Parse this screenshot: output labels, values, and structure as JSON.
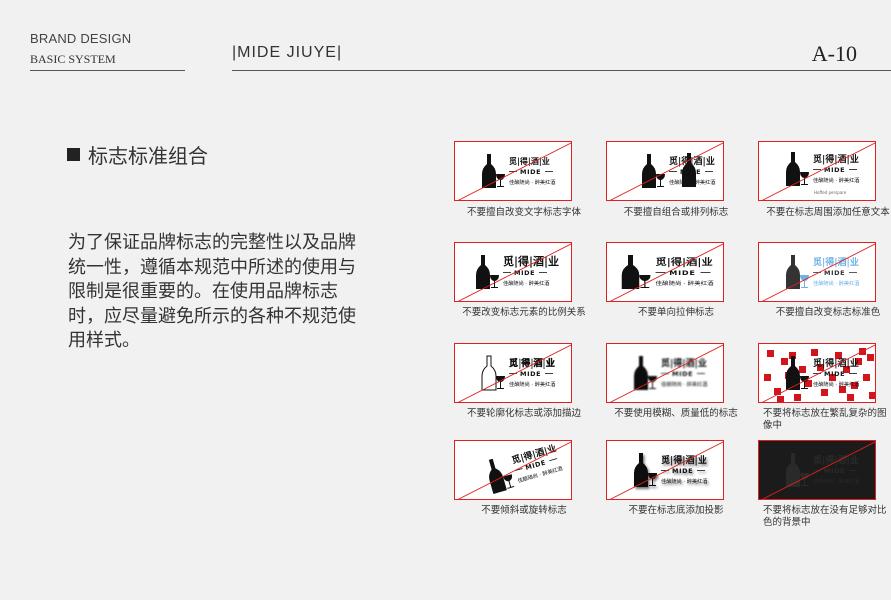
{
  "header": {
    "brand_line1": "BRAND DESIGN",
    "brand_line2": "BASIC SYSTEM",
    "project": "|MIDE  JIUYE|",
    "page_code": "A-10"
  },
  "section": {
    "title": "标志标准组合",
    "description": "为了保证品牌标志的完整性以及品牌统一性，遵循本规范中所述的使用与限制是很重要的。在使用品牌标志时，应尽量避免所示的各种不规范使用样式。"
  },
  "logo_text": {
    "name": "觅|得|酒|业",
    "mide": "MIDE",
    "slogan": "佳酿随尚 · 醉美红酒",
    "sub": "Hoffed perspare"
  },
  "examples": [
    {
      "caption": "不要擅自改变文字标志字体"
    },
    {
      "caption": "不要擅自组合或排列标志"
    },
    {
      "caption": "不要在标志周围添加任意文本"
    },
    {
      "caption": "不要改变标志元素的比例关系"
    },
    {
      "caption": "不要单向拉伸标志"
    },
    {
      "caption": "不要擅自改变标志标准色"
    },
    {
      "caption": "不要轮廓化标志或添加描边"
    },
    {
      "caption": "不要使用模糊、质量低的标志"
    },
    {
      "caption": "不要将标志放在繁乱复杂的图像中"
    },
    {
      "caption": "不要倾斜或旋转标志"
    },
    {
      "caption": "不要在标志底添加投影"
    },
    {
      "caption": "不要将标志放在没有足够对比色的背景中"
    }
  ],
  "colors": {
    "strike": "#e02020",
    "noise": "#d4141c",
    "dark_bg": "#1b1b1b",
    "light_blue": "#6fb2e6"
  }
}
